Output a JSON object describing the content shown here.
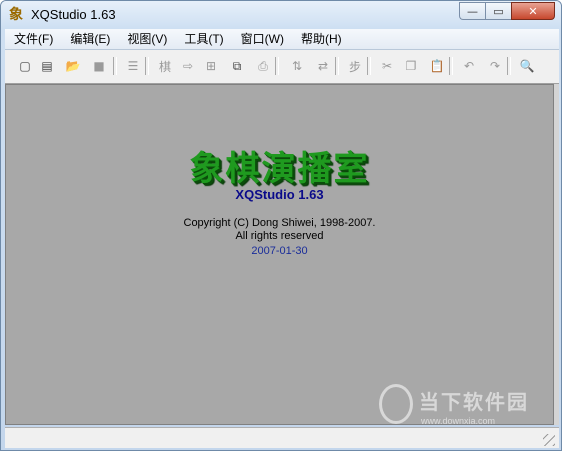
{
  "window": {
    "title": "XQStudio 1.63"
  },
  "menu": {
    "items": [
      {
        "label": "文件(F)"
      },
      {
        "label": "编辑(E)"
      },
      {
        "label": "视图(V)"
      },
      {
        "label": "工具(T)"
      },
      {
        "label": "窗口(W)"
      },
      {
        "label": "帮助(H)"
      }
    ]
  },
  "toolbar": {
    "buttons": [
      {
        "icon": "new-file-icon",
        "glyph": "▢",
        "enabled": true
      },
      {
        "icon": "new-template-icon",
        "glyph": "▤",
        "enabled": true
      },
      {
        "icon": "open-folder-icon",
        "glyph": "📂",
        "enabled": true
      },
      {
        "icon": "save-icon",
        "glyph": "■",
        "enabled": false
      },
      {
        "icon": "properties-icon",
        "glyph": "☰",
        "enabled": false
      },
      {
        "icon": "board-icon",
        "glyph": "棋",
        "enabled": false
      },
      {
        "icon": "export-icon",
        "glyph": "⇨",
        "enabled": false
      },
      {
        "icon": "open-board-icon",
        "glyph": "⊞",
        "enabled": false
      },
      {
        "icon": "copy-board-icon",
        "glyph": "⧉",
        "enabled": true
      },
      {
        "icon": "print-icon",
        "glyph": "⎙",
        "enabled": false
      },
      {
        "icon": "swap-vertical-icon",
        "glyph": "⇅",
        "enabled": false
      },
      {
        "icon": "swap-horizontal-icon",
        "glyph": "⇄",
        "enabled": false
      },
      {
        "icon": "move-step-icon",
        "glyph": "步",
        "enabled": false
      },
      {
        "icon": "cut-icon",
        "glyph": "✂",
        "enabled": false
      },
      {
        "icon": "copy-icon",
        "glyph": "❐",
        "enabled": false
      },
      {
        "icon": "paste-icon",
        "glyph": "📋",
        "enabled": false
      },
      {
        "icon": "page-prev-icon",
        "glyph": "↶",
        "enabled": false
      },
      {
        "icon": "page-next-icon",
        "glyph": "↷",
        "enabled": false
      },
      {
        "icon": "preview-icon",
        "glyph": "🔍",
        "enabled": true
      }
    ]
  },
  "splash": {
    "chinese_title": "象棋演播室",
    "version": "XQStudio 1.63",
    "copyright": "Copyright (C) Dong Shiwei, 1998-2007.",
    "rights": "All rights reserved",
    "date": "2007-01-30"
  },
  "watermark": {
    "text": "当下软件园",
    "url": "www.downxia.com"
  },
  "colors": {
    "client_bg": "#a8a8a8",
    "title_green": "#1f9a1f",
    "version_blue": "#0a0a8a",
    "date_blue": "#1a2d9a"
  }
}
